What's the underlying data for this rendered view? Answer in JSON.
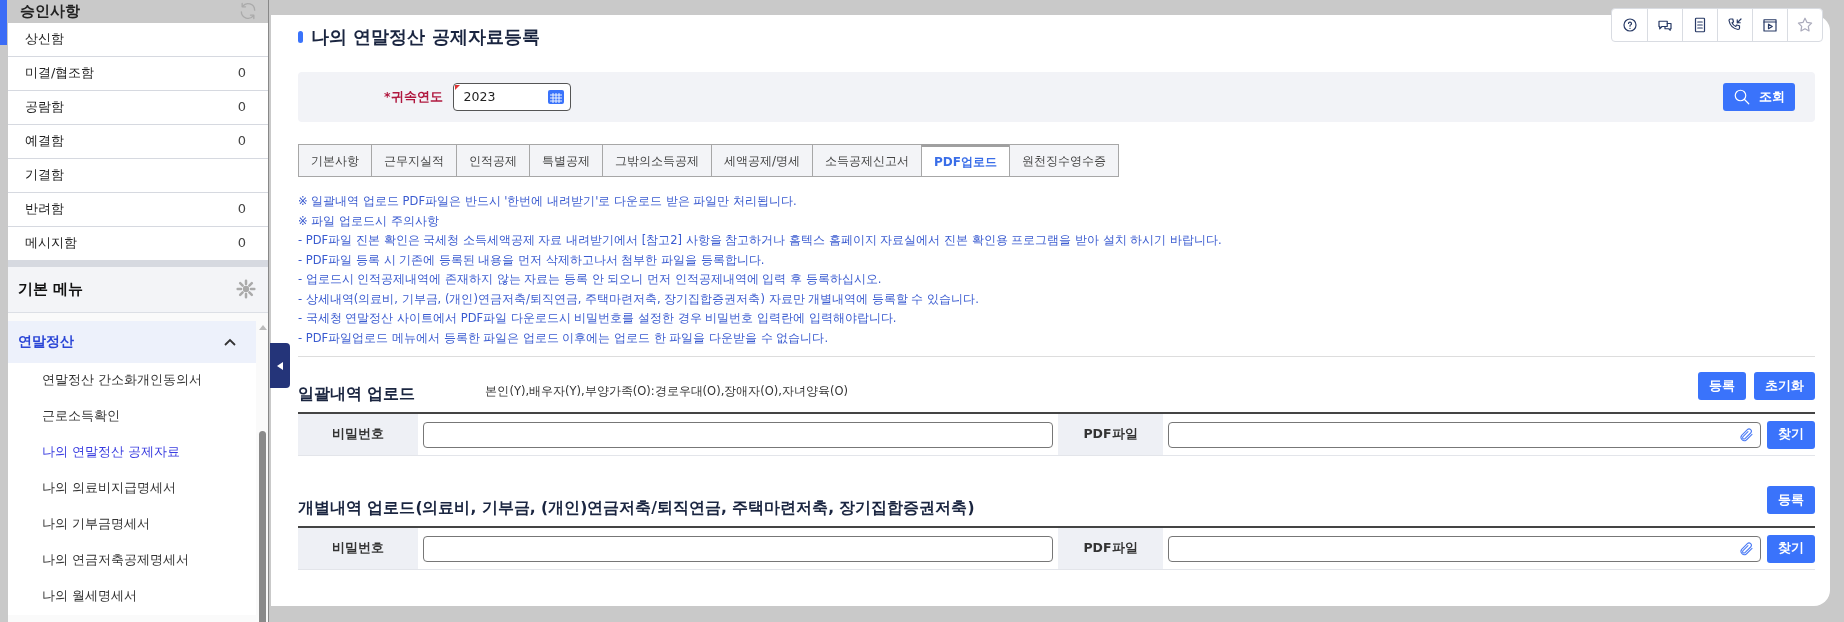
{
  "sidebar": {
    "approvals": {
      "title": "승인사항",
      "items": [
        {
          "label": "상신함"
        },
        {
          "label": "미결/협조함",
          "count": "0"
        },
        {
          "label": "공람함",
          "count": "0"
        },
        {
          "label": "예결함",
          "count": "0"
        },
        {
          "label": "기결함"
        },
        {
          "label": "반려함",
          "count": "0"
        },
        {
          "label": "메시지함",
          "count": "0"
        }
      ]
    },
    "basic_menu": {
      "title": "기본 메뉴",
      "group": {
        "label": "연말정산",
        "expanded": true,
        "children": [
          {
            "label": "연말정산 간소화개인동의서",
            "selected": false
          },
          {
            "label": "근로소득확인",
            "selected": false
          },
          {
            "label": "나의 연말정산 공제자료",
            "selected": true
          },
          {
            "label": "나의 의료비지급명세서",
            "selected": false
          },
          {
            "label": "나의 기부금명세서",
            "selected": false
          },
          {
            "label": "나의 연금저축공제명세서",
            "selected": false
          },
          {
            "label": "나의 월세명세서",
            "selected": false
          }
        ]
      }
    }
  },
  "page": {
    "title": "나의 연말정산 공제자료등록",
    "search": {
      "label": "*귀속연도",
      "value": "2023",
      "button": "조회"
    },
    "tabs": [
      {
        "label": "기본사항",
        "selected": false
      },
      {
        "label": "근무지실적",
        "selected": false
      },
      {
        "label": "인적공제",
        "selected": false
      },
      {
        "label": "특별공제",
        "selected": false
      },
      {
        "label": "그밖의소득공제",
        "selected": false
      },
      {
        "label": "세액공제/명세",
        "selected": false
      },
      {
        "label": "소득공제신고서",
        "selected": false
      },
      {
        "label": "PDF업로드",
        "selected": true
      },
      {
        "label": "원천징수영수증",
        "selected": false
      }
    ],
    "notices": [
      "※ 일괄내역 업로드 PDF파일은 반드시 '한번에 내려받기'로 다운로드 받은 파일만 처리됩니다.",
      "※ 파일 업로드시 주의사항",
      "- PDF파일 진본 확인은 국세청 소득세액공제 자료 내려받기에서 [참고2] 사항을 참고하거나 홈텍스 홈페이지 자료실에서 진본 확인용 프로그램을 받아 설치 하시기 바랍니다.",
      "- PDF파일 등록 시 기존에 등록된 내용을 먼저 삭제하고나서 첨부한 파일을 등록합니다.",
      "- 업로드시 인적공제내역에 존재하지 않는 자료는 등록 안 되오니 먼저 인적공제내역에  입력 후 등록하십시오.",
      "- 상세내역(의료비, 기부금, (개인)연금저축/퇴직연금, 주택마련저축, 장기집합증권저축) 자료만 개별내역에 등록할 수 있습니다.",
      "- 국세청 연말정산 사이트에서 PDF파일 다운로드시 비밀번호를 설정한 경우 비밀번호 입력란에 입력해야랍니다.",
      "- PDF파일업로드 메뉴에서 등록한 파일은 업로드 이후에는 업로드 한 파일을 다운받을 수 없습니다."
    ],
    "sections": [
      {
        "title": "일괄내역 업로드",
        "note": "본인(Y),배우자(Y),부양가족(O):경로우대(O),장애자(O),자녀양육(O)",
        "buttons": [
          "등록",
          "초기화"
        ],
        "password_label": "비밀번호",
        "file_label": "PDF파일",
        "find_button": "찾기"
      },
      {
        "title": "개별내역 업로드(의료비, 기부금, (개인)연금저축/퇴직연금, 주택마련저축, 장기집합증권저축)",
        "buttons": [
          "등록"
        ],
        "password_label": "비밀번호",
        "file_label": "PDF파일",
        "find_button": "찾기"
      }
    ]
  }
}
